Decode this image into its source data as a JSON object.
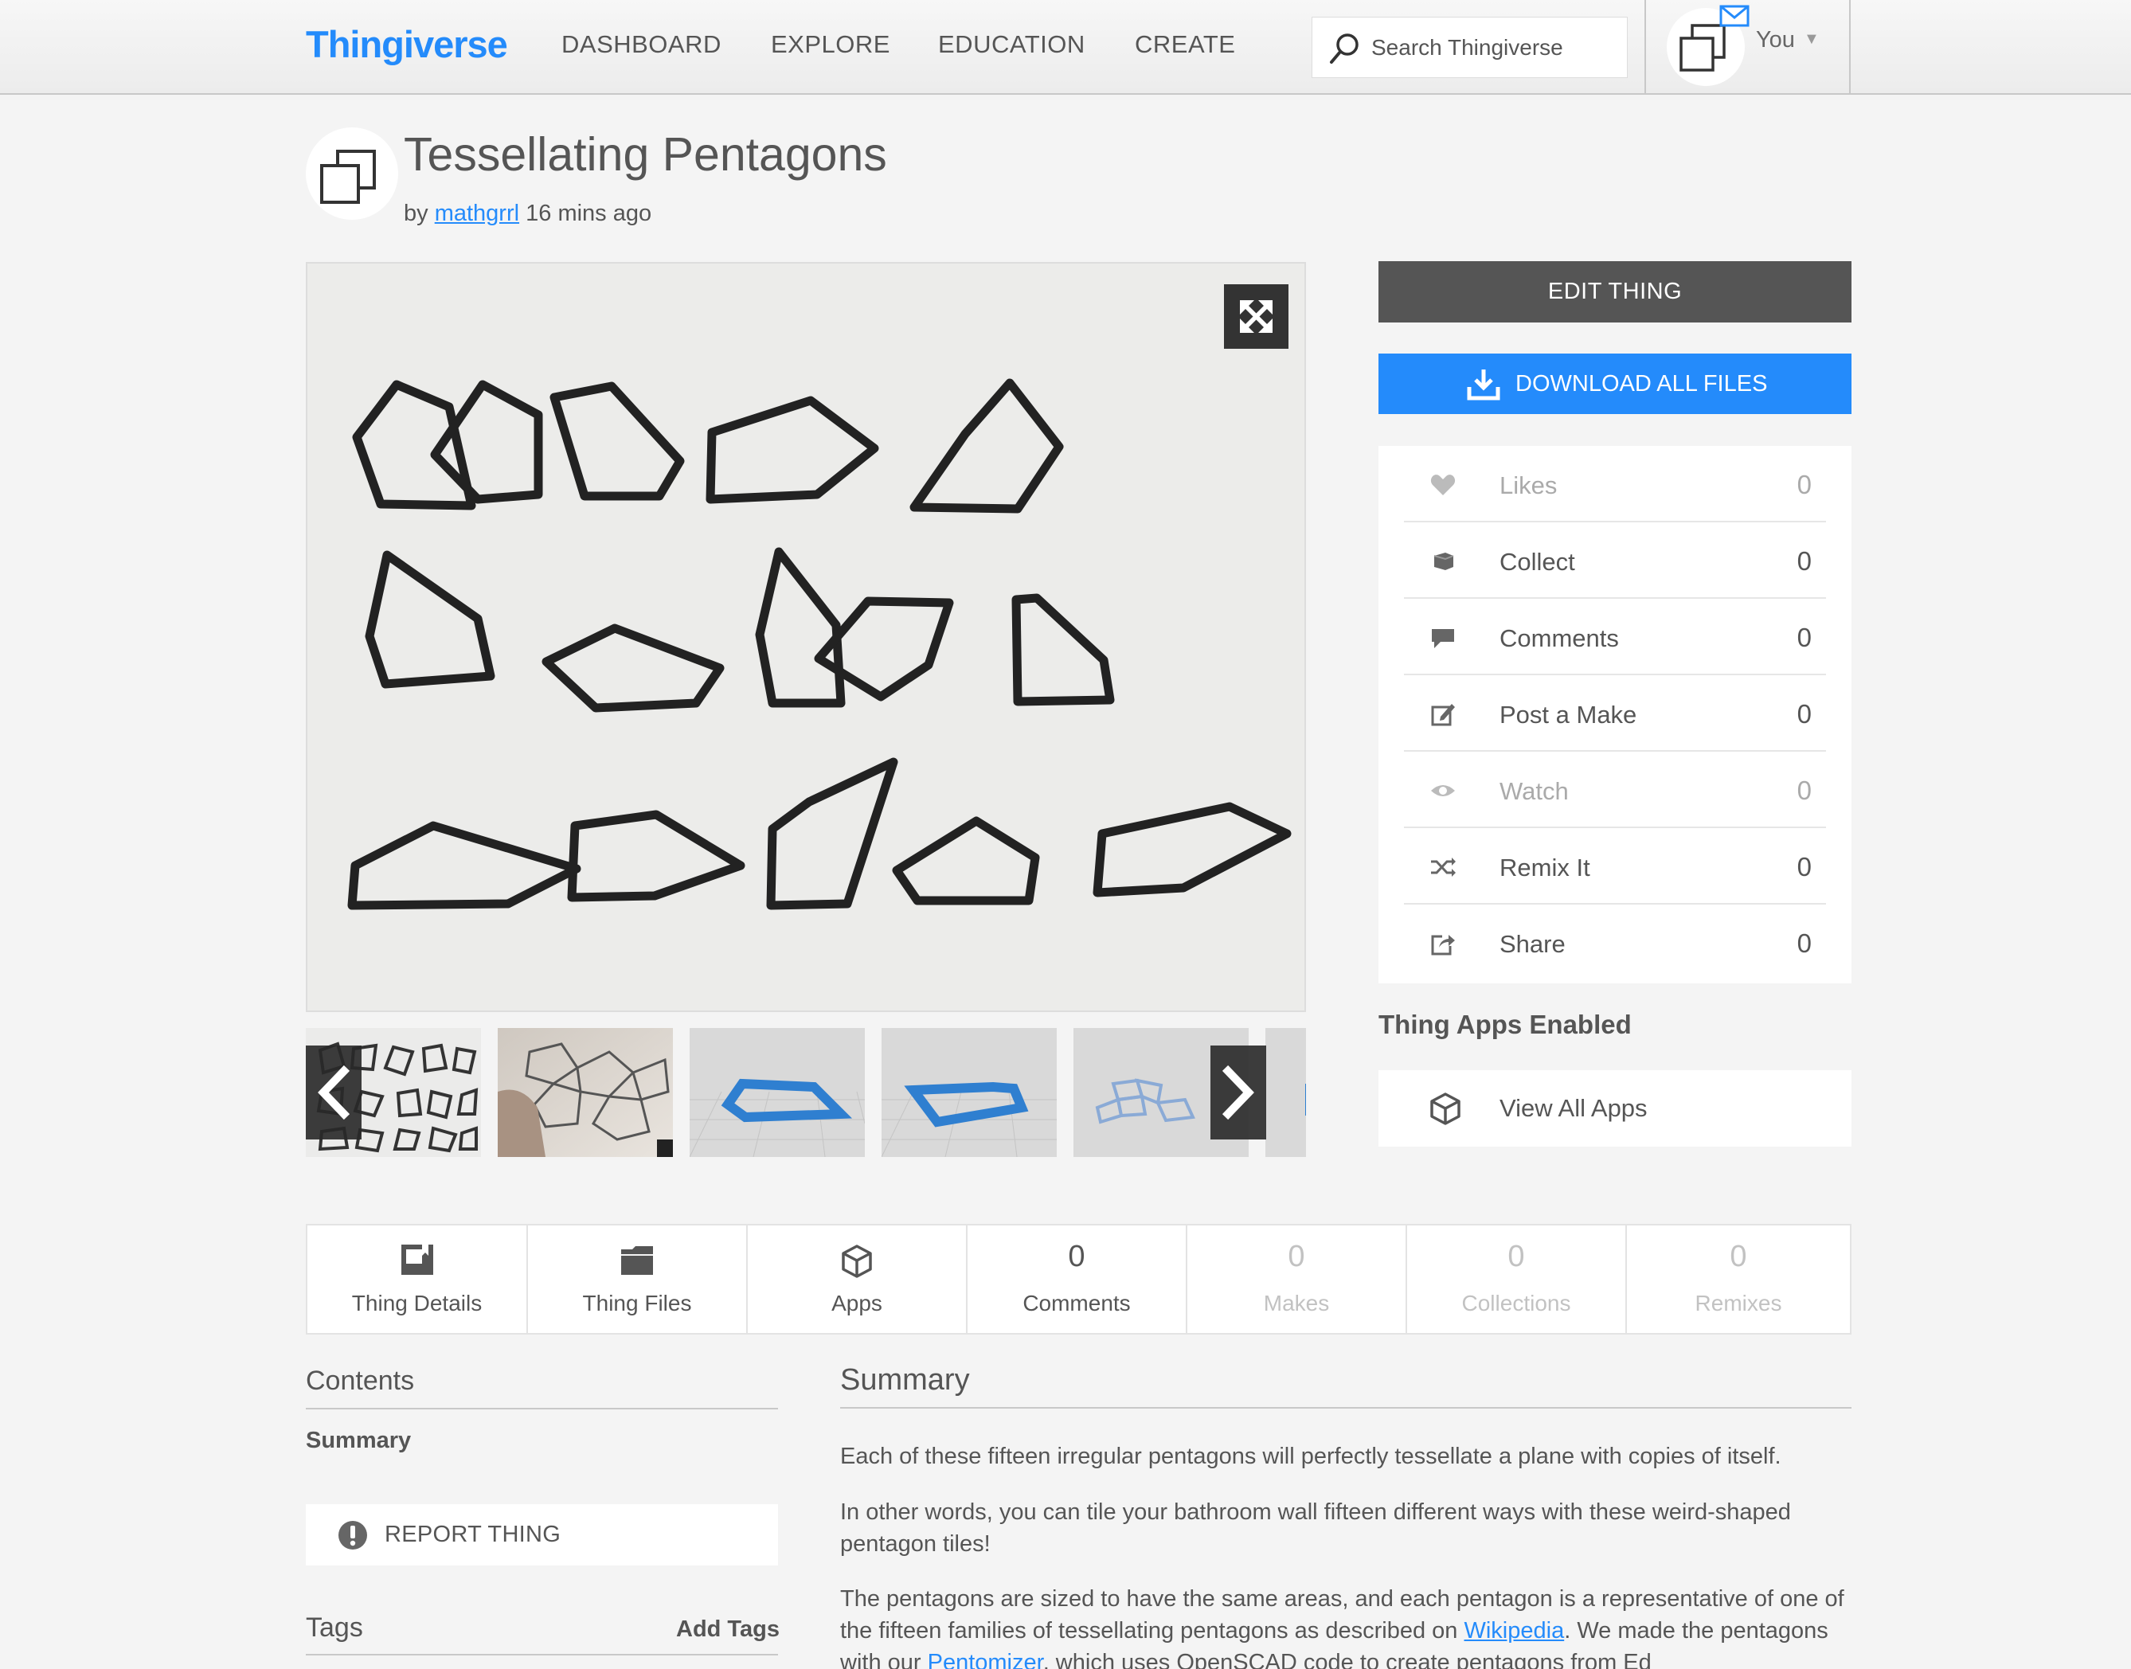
{
  "nav": {
    "logo": "Thingiverse",
    "links": [
      "DASHBOARD",
      "EXPLORE",
      "EDUCATION",
      "CREATE"
    ],
    "search_placeholder": "Search Thingiverse",
    "user_label": "You",
    "chevron": "▼"
  },
  "thing": {
    "title": "Tessellating Pentagons",
    "by": "by",
    "author": "mathgrrl",
    "time": "16 mins ago"
  },
  "actions": {
    "edit_label": "EDIT THING",
    "download_label": "DOWNLOAD ALL FILES"
  },
  "stats": [
    {
      "label": "Likes",
      "count": "0",
      "icon": "heart-icon",
      "dim": true
    },
    {
      "label": "Collect",
      "count": "0",
      "icon": "collect-icon",
      "dim": false
    },
    {
      "label": "Comments",
      "count": "0",
      "icon": "comment-icon",
      "dim": false
    },
    {
      "label": "Post a Make",
      "count": "0",
      "icon": "edit-icon",
      "dim": false
    },
    {
      "label": "Watch",
      "count": "0",
      "icon": "eye-icon",
      "dim": true
    },
    {
      "label": "Remix It",
      "count": "0",
      "icon": "shuffle-icon",
      "dim": false
    },
    {
      "label": "Share",
      "count": "0",
      "icon": "share-icon",
      "dim": false
    }
  ],
  "apps": {
    "heading": "Thing Apps Enabled",
    "view_all": "View All Apps"
  },
  "tabs": [
    {
      "label": "Thing Details",
      "icon": "details-icon"
    },
    {
      "label": "Thing Files",
      "icon": "folder-icon"
    },
    {
      "label": "Apps",
      "icon": "cube-icon"
    },
    {
      "label": "Comments",
      "count": "0"
    },
    {
      "label": "Makes",
      "count": "0"
    },
    {
      "label": "Collections",
      "count": "0"
    },
    {
      "label": "Remixes",
      "count": "0"
    }
  ],
  "sidebar": {
    "contents_heading": "Contents",
    "summary_link": "Summary",
    "report_label": "REPORT THING",
    "tags_heading": "Tags",
    "add_tags": "Add Tags"
  },
  "summary": {
    "heading": "Summary",
    "p1": "Each of these fifteen irregular pentagons will perfectly tessellate a plane with copies of itself.",
    "p2": "In other words, you can tile your bathroom wall fifteen different ways with these weird-shaped pentagon tiles!",
    "p3_a": "The pentagons are sized to have the same areas, and each pentagon is a representative of one of the fifteen families of tessellating pentagons as described on ",
    "p3_link1": "Wikipedia",
    "p3_b": ". We made the pentagons with our ",
    "p3_link2": "Pentomizer",
    "p3_c": ", which uses OpenSCAD code to create pentagons from Ed"
  }
}
